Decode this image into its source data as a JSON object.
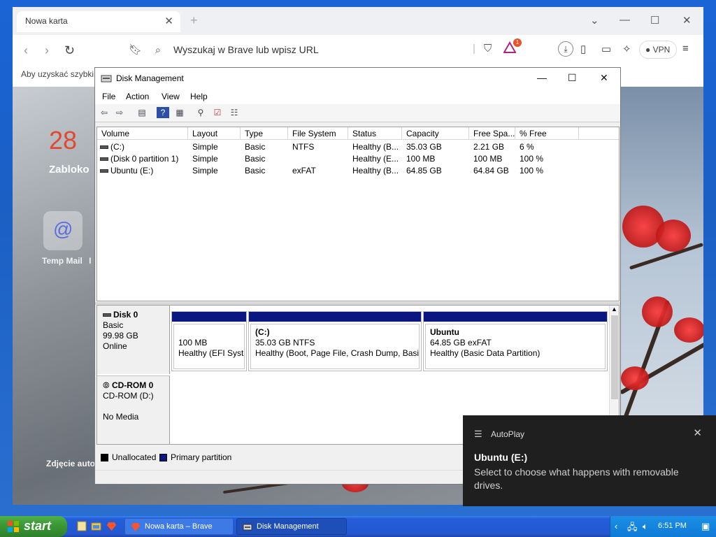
{
  "browser": {
    "tab_title": "Nowa karta",
    "url_placeholder": "Wyszukaj w Brave lub wpisz URL",
    "vpn_label": "VPN",
    "badge_count": "1",
    "bookmarks_text": "Aby uzyskać szybki d",
    "newtab": {
      "clock_day": "28",
      "status_text": "Zabloko",
      "tile_label": "Temp Mail",
      "tile_label_extra": "I",
      "photo_credit": "Zdjęcie auto"
    }
  },
  "disk_management": {
    "title": "Disk Management",
    "menu": [
      "File",
      "Action",
      "View",
      "Help"
    ],
    "columns": [
      "Volume",
      "Layout",
      "Type",
      "File System",
      "Status",
      "Capacity",
      "Free Spa...",
      "% Free"
    ],
    "volumes": [
      {
        "volume": "(C:)",
        "layout": "Simple",
        "type": "Basic",
        "fs": "NTFS",
        "status": "Healthy (B...",
        "capacity": "35.03 GB",
        "free": "2.21 GB",
        "pct": "6 %"
      },
      {
        "volume": "(Disk 0 partition 1)",
        "layout": "Simple",
        "type": "Basic",
        "fs": "",
        "status": "Healthy (E...",
        "capacity": "100 MB",
        "free": "100 MB",
        "pct": "100 %"
      },
      {
        "volume": "Ubuntu (E:)",
        "layout": "Simple",
        "type": "Basic",
        "fs": "exFAT",
        "status": "Healthy (B...",
        "capacity": "64.85 GB",
        "free": "64.84 GB",
        "pct": "100 %"
      }
    ],
    "disk0": {
      "name": "Disk 0",
      "type": "Basic",
      "size": "99.98 GB",
      "state": "Online",
      "partitions": [
        {
          "name": "",
          "size": "100 MB",
          "status": "Healthy (EFI Syste"
        },
        {
          "name": "(C:)",
          "size": "35.03 GB NTFS",
          "status": "Healthy (Boot, Page File, Crash Dump, Basic"
        },
        {
          "name": "Ubuntu",
          "size": "64.85 GB exFAT",
          "status": "Healthy (Basic Data Partition)"
        }
      ]
    },
    "cdrom0": {
      "name": "CD-ROM 0",
      "drive": "CD-ROM (D:)",
      "media": "No Media"
    },
    "legend": {
      "unallocated": "Unallocated",
      "primary": "Primary partition",
      "unallocated_color": "#000000",
      "primary_color": "#0a1780"
    }
  },
  "toast": {
    "app": "AutoPlay",
    "title": "Ubuntu (E:)",
    "message": "Select to choose what happens with removable drives."
  },
  "taskbar": {
    "start_label": "start",
    "tasks": [
      "Nowa karta – Brave",
      "Disk Management"
    ],
    "clock": "6:51 PM"
  }
}
